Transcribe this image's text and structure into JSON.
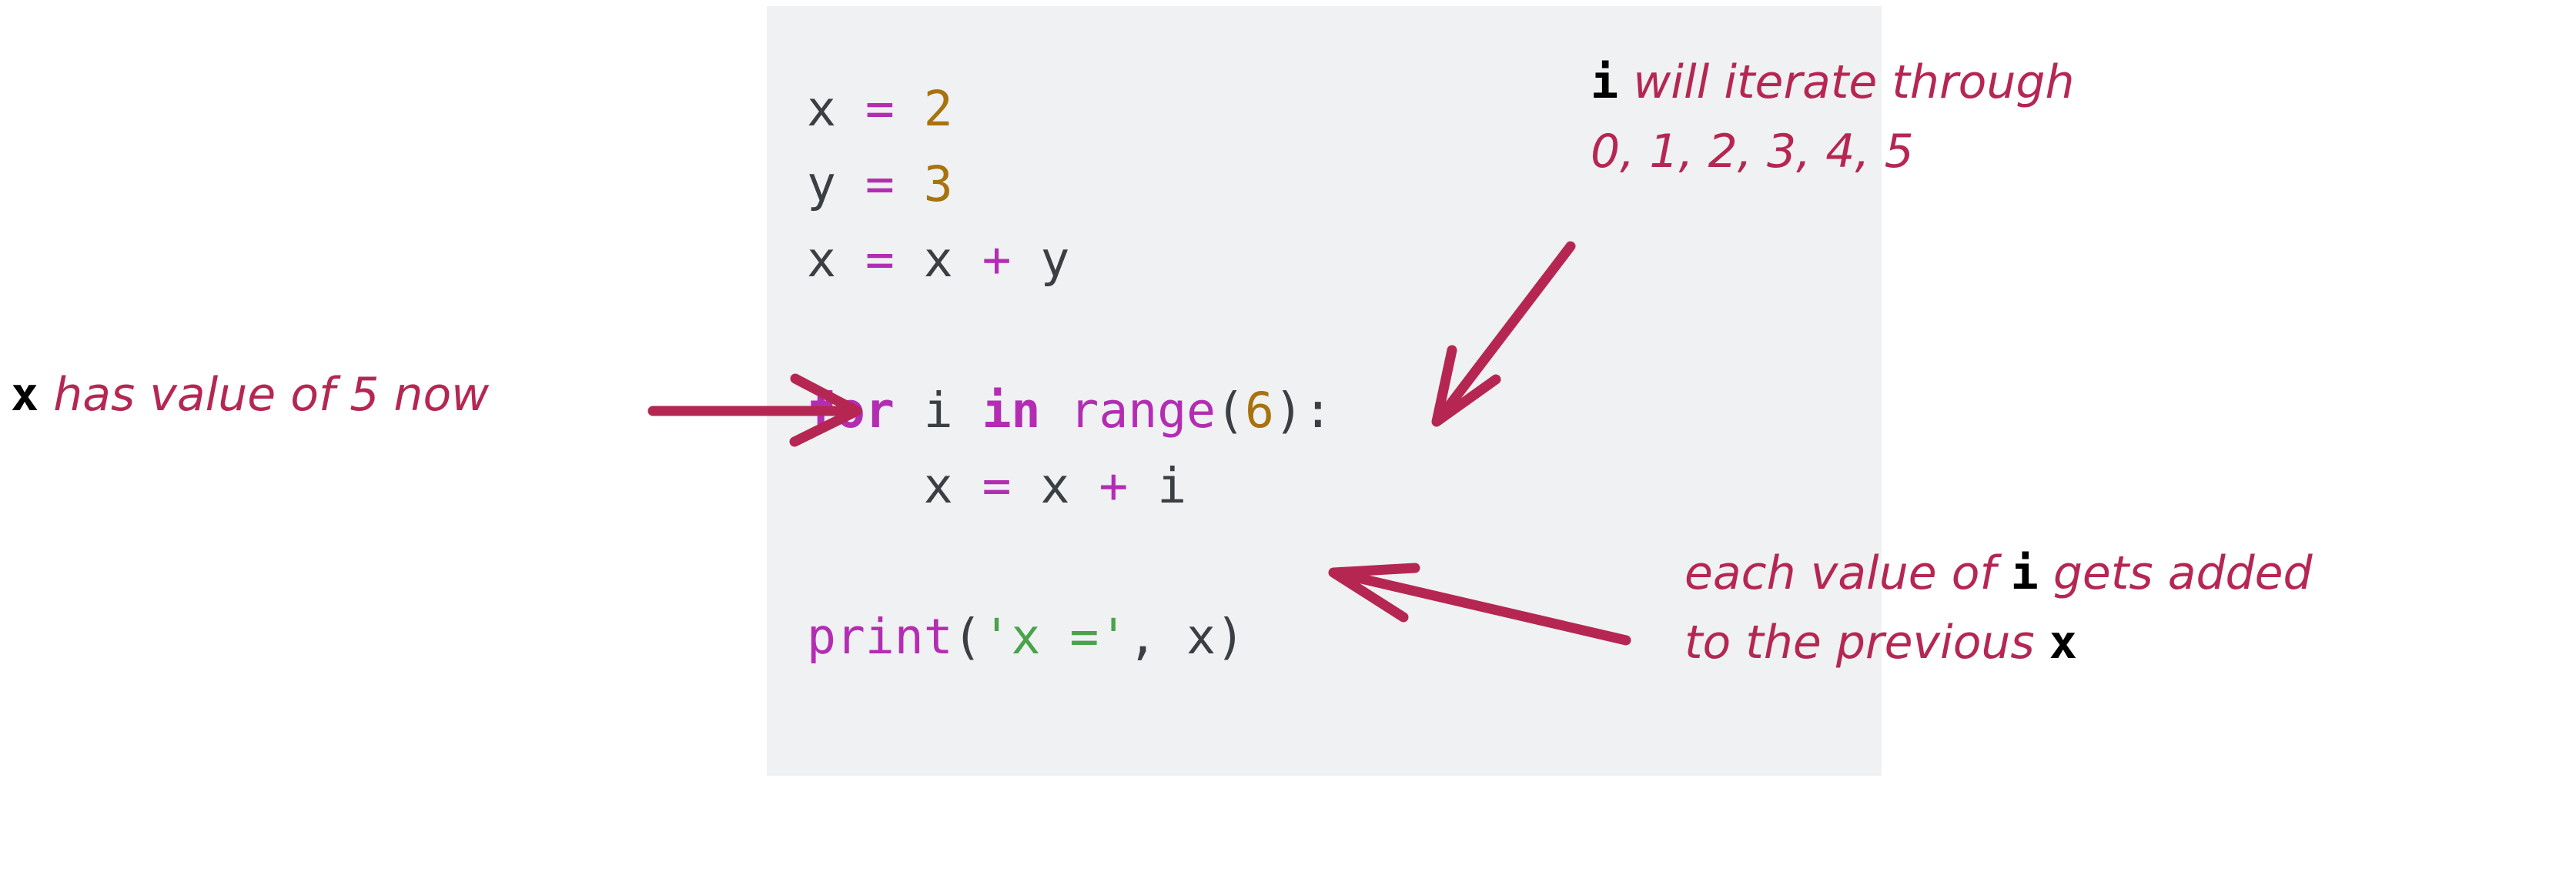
{
  "figure": {
    "kind": "annotated-python-code",
    "background_color": "#ffffff",
    "code_block_color": "#eff1f2",
    "annotation_color": "#b52752",
    "code_text_color": "#3b3f44"
  },
  "code": {
    "language": "python",
    "lines": [
      {
        "id": "line-1",
        "text": "x = 2"
      },
      {
        "id": "line-2",
        "text": "y = 3"
      },
      {
        "id": "line-3",
        "text": "x = x + y"
      },
      {
        "id": "line-4",
        "text": ""
      },
      {
        "id": "line-5",
        "text": "for i in range(6):"
      },
      {
        "id": "line-6",
        "text": "    x = x + i"
      },
      {
        "id": "line-7",
        "text": ""
      },
      {
        "id": "line-8",
        "text": "print('x =', x)"
      }
    ],
    "tokens": {
      "var_x": "x",
      "var_y": "y",
      "var_i": "i",
      "assign": "=",
      "plus": "+",
      "num_2": "2",
      "num_3": "3",
      "num_6": "6",
      "kw_for": "for",
      "kw_in": "in",
      "builtin_range": "range",
      "builtin_print": "print",
      "paren_open": "(",
      "paren_close": ")",
      "colon": ":",
      "comma": ",",
      "string_x_eq": "'x ='",
      "indent": "    "
    },
    "colors": {
      "operator": "#b32db3",
      "number": "#a8720c",
      "keyword": "#b32db3",
      "builtin": "#b32db3",
      "string": "#4aa24a",
      "name": "#3b3f44"
    }
  },
  "annotations": [
    {
      "id": "x-has-value",
      "lines": [
        {
          "prefix_code": "x",
          "text": " has value of 5 now"
        }
      ],
      "arrow": "right-arrow-to-for-line"
    },
    {
      "id": "i-will-iterate",
      "lines": [
        {
          "prefix_code": "i",
          "text": " will iterate through"
        },
        {
          "prefix_code": "",
          "text": "0, 1, 2, 3, 4, 5"
        }
      ],
      "arrow": "down-left-arrow-to-i-in-for"
    },
    {
      "id": "each-value-added",
      "lines": [
        {
          "pre": "each value of ",
          "code": "i",
          "post": " gets added"
        },
        {
          "pre": "to the previous ",
          "code": "x",
          "post": ""
        }
      ],
      "arrow": "left-arrow-to-loop-body"
    }
  ]
}
